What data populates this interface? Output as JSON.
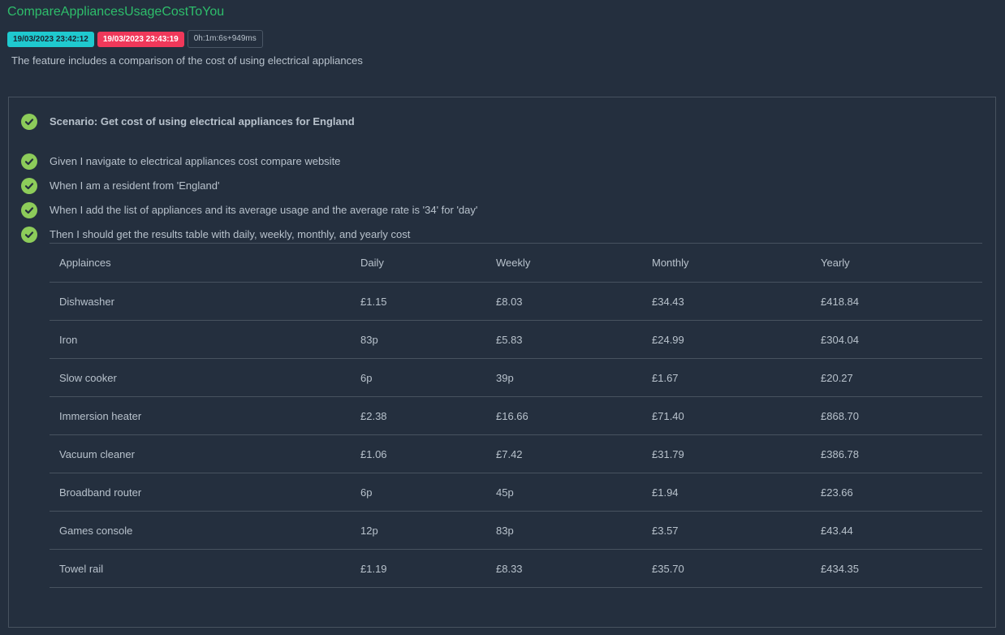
{
  "feature": {
    "title": "CompareAppliancesUsageCostToYou",
    "start_time": "19/03/2023 23:42:12",
    "end_time": "19/03/2023 23:43:19",
    "duration": "0h:1m:6s+949ms",
    "description": "The feature includes a comparison of the cost of using electrical appliances"
  },
  "colors": {
    "title": "#2ebd6b",
    "start_badge": "#1fc9cf",
    "end_badge": "#f0385a",
    "passed_check": "#8dcc5a",
    "background": "#242f3e"
  },
  "scenario": {
    "title": "Scenario: Get cost of using electrical appliances for England",
    "status_icon": "check-circle-icon",
    "steps": [
      "Given I navigate to electrical appliances cost compare website",
      "When I am a resident from 'England'",
      "When I add the list of appliances and its average usage and the average rate is '34' for 'day'",
      "Then I should get the results table with daily, weekly, monthly, and yearly cost"
    ]
  },
  "table": {
    "headers": [
      "Applainces",
      "Daily",
      "Weekly",
      "Monthly",
      "Yearly"
    ],
    "rows": [
      [
        "Dishwasher",
        "£1.15",
        "£8.03",
        "£34.43",
        "£418.84"
      ],
      [
        "Iron",
        "83p",
        "£5.83",
        "£24.99",
        "£304.04"
      ],
      [
        "Slow cooker",
        "6p",
        "39p",
        "£1.67",
        "£20.27"
      ],
      [
        "Immersion heater",
        "£2.38",
        "£16.66",
        "£71.40",
        "£868.70"
      ],
      [
        "Vacuum cleaner",
        "£1.06",
        "£7.42",
        "£31.79",
        "£386.78"
      ],
      [
        "Broadband router",
        "6p",
        "45p",
        "£1.94",
        "£23.66"
      ],
      [
        "Games console",
        "12p",
        "83p",
        "£3.57",
        "£43.44"
      ],
      [
        "Towel rail",
        "£1.19",
        "£8.33",
        "£35.70",
        "£434.35"
      ]
    ]
  }
}
